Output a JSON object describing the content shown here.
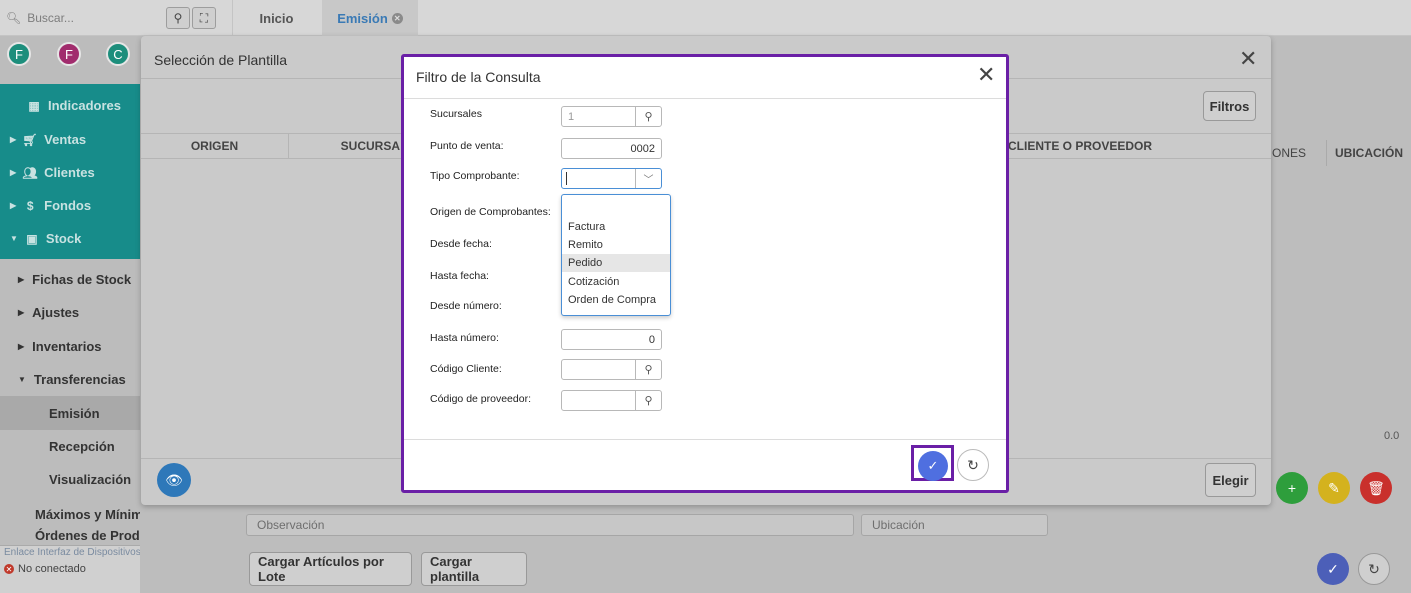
{
  "topbar": {
    "search_placeholder": "Buscar...",
    "search_icon": "search-icon",
    "expand_icon": "expand-icon",
    "tabs": [
      {
        "label": "Inicio"
      },
      {
        "label": "Emisión"
      }
    ]
  },
  "avatars": [
    {
      "letter": "F",
      "color": "#1d8e7c"
    },
    {
      "letter": "F",
      "color": "#a12c6d"
    },
    {
      "letter": "C",
      "color": "#1d8e7c"
    }
  ],
  "sidebar": {
    "items": [
      {
        "label": "Indicadores",
        "icon": "dashboard-icon"
      },
      {
        "label": "Ventas",
        "icon": "cart-icon"
      },
      {
        "label": "Clientes",
        "icon": "people-icon"
      },
      {
        "label": "Fondos",
        "icon": "dollar-icon"
      },
      {
        "label": "Stock",
        "icon": "box-icon"
      }
    ],
    "stock_items": [
      {
        "label": "Fichas de Stock"
      },
      {
        "label": "Ajustes"
      },
      {
        "label": "Inventarios"
      },
      {
        "label": "Transferencias"
      },
      {
        "label": "Emisión"
      },
      {
        "label": "Recepción"
      },
      {
        "label": "Visualización"
      },
      {
        "label": "Máximos y Mínimos de Stock"
      },
      {
        "label": "Órdenes de Producción"
      }
    ]
  },
  "device": {
    "link": "Enlace Interfaz de Dispositivos",
    "status": "No conectado"
  },
  "background": {
    "observacion_placeholder": "Observación",
    "ubicacion_placeholder": "Ubicación",
    "cargar_lote_label": "Cargar Artículos por Lote",
    "cargar_plantilla_label": "Cargar plantilla",
    "col_ones": "ONES",
    "col_ubicacion": "UBICACIÓN",
    "total": "0.0"
  },
  "plantilla_modal": {
    "title": "Selección de Plantilla",
    "filtros_label": "Filtros",
    "elegir_label": "Elegir",
    "columns": [
      "ORIGEN",
      "SUCURSA",
      "CLIENTE O PROVEEDOR"
    ]
  },
  "filtro_modal": {
    "title": "Filtro de la Consulta",
    "fields": {
      "sucursales_label": "Sucursales",
      "sucursales_value": "1",
      "punto_venta_label": "Punto de venta:",
      "punto_venta_value": "0002",
      "tipo_comprobante_label": "Tipo Comprobante:",
      "origen_label": "Origen de Comprobantes:",
      "desde_fecha_label": "Desde fecha:",
      "hasta_fecha_label": "Hasta fecha:",
      "desde_numero_label": "Desde número:",
      "hasta_numero_label": "Hasta número:",
      "hasta_numero_value": "0",
      "codigo_cliente_label": "Código Cliente:",
      "codigo_proveedor_label": "Código de proveedor:"
    },
    "dropdown_options": [
      "Factura",
      "Remito",
      "Pedido",
      "Cotización",
      "Orden de Compra"
    ],
    "highlighted_option": "Pedido"
  },
  "colors": {
    "teal": "#178c8a",
    "purple_highlight": "#6a1fa6",
    "ok_blue": "#4f6fe0",
    "green": "#2e9e3c",
    "yellow": "#d4b21e",
    "red": "#c9302c"
  }
}
